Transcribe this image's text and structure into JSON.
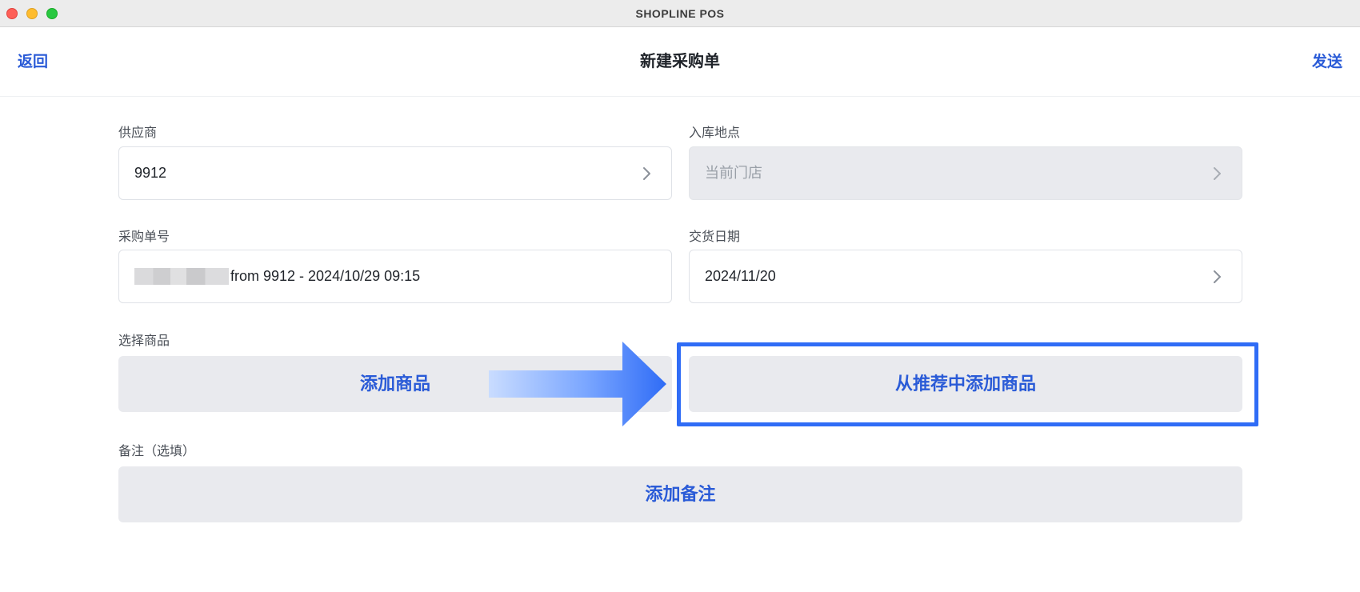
{
  "window": {
    "title": "SHOPLINE POS"
  },
  "nav": {
    "back_label": "返回",
    "title": "新建采购单",
    "send_label": "发送"
  },
  "form": {
    "supplier": {
      "label": "供应商",
      "value": "9912"
    },
    "location": {
      "label": "入库地点",
      "value": "当前门店",
      "disabled": true
    },
    "po_number": {
      "label": "采购单号",
      "value": "from 9912 - 2024/10/29 09:15"
    },
    "delivery_date": {
      "label": "交货日期",
      "value": "2024/11/20"
    },
    "products": {
      "label": "选择商品",
      "add_button": "添加商品",
      "add_recommended_button": "从推荐中添加商品"
    },
    "note": {
      "label": "备注（选填）",
      "add_button": "添加备注"
    }
  },
  "colors": {
    "accent": "#2a5bd7",
    "highlight": "#2f6cf6",
    "button_bg": "#e9eaee"
  },
  "icons": {
    "field_chevron": "chevron-right-icon",
    "annotation_arrow": "arrow-right-icon"
  }
}
